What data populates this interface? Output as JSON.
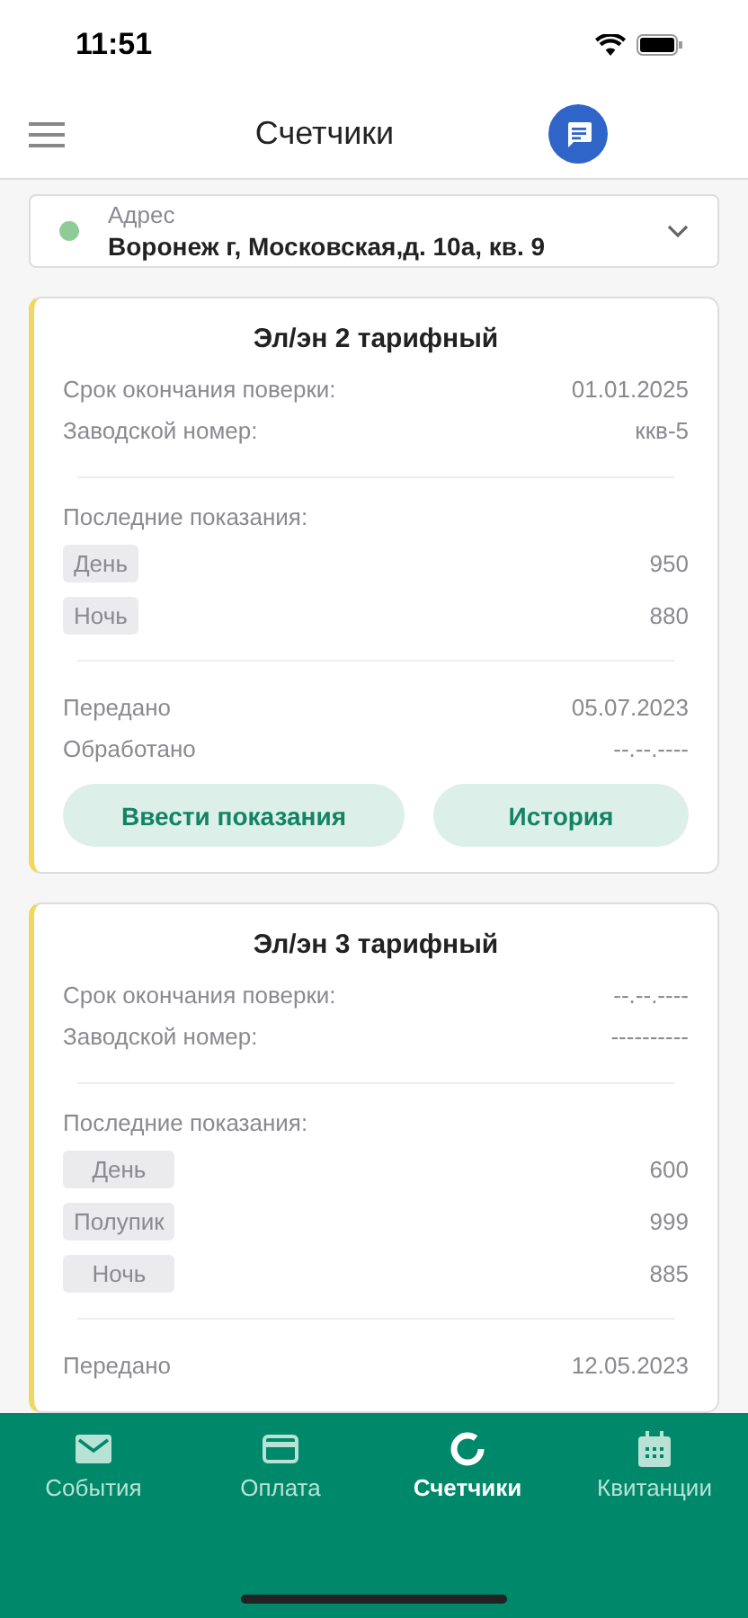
{
  "status_bar": {
    "time": "11:51"
  },
  "header": {
    "title": "Счетчики"
  },
  "address": {
    "label": "Адрес",
    "value": "Воронеж г, Московская,д. 10а, кв. 9",
    "color": "#8fcb96"
  },
  "meters": [
    {
      "title": "Эл/эн 2 тарифный",
      "info": [
        {
          "label": "Срок окончания поверки:",
          "value": "01.01.2025"
        },
        {
          "label": "Заводской номер:",
          "value": "ккв-5"
        }
      ],
      "readings_label": "Последние показания:",
      "readings": [
        {
          "tariff": "День",
          "value": "950"
        },
        {
          "tariff": "Ночь",
          "value": "880"
        }
      ],
      "status": [
        {
          "label": "Передано",
          "value": "05.07.2023"
        },
        {
          "label": "Обработано",
          "value": "--.--.----"
        }
      ],
      "buttons": [
        "Ввести показания",
        "История"
      ]
    },
    {
      "title": "Эл/эн 3 тарифный",
      "info": [
        {
          "label": "Срок окончания поверки:",
          "value": "--.--.----"
        },
        {
          "label": "Заводской номер:",
          "value": "----------"
        }
      ],
      "readings_label": "Последние показания:",
      "readings": [
        {
          "tariff": "День",
          "value": "600"
        },
        {
          "tariff": "Полупик",
          "value": "999"
        },
        {
          "tariff": "Ночь",
          "value": "885"
        }
      ],
      "status": [
        {
          "label": "Передано",
          "value": "12.05.2023"
        }
      ]
    }
  ],
  "tabs": [
    {
      "label": "События",
      "kind": "mail",
      "selected": false
    },
    {
      "label": "Оплата",
      "kind": "card",
      "selected": false
    },
    {
      "label": "Счетчики",
      "kind": "ring",
      "selected": true
    },
    {
      "label": "Квитанции",
      "kind": "calendar",
      "selected": false
    }
  ]
}
